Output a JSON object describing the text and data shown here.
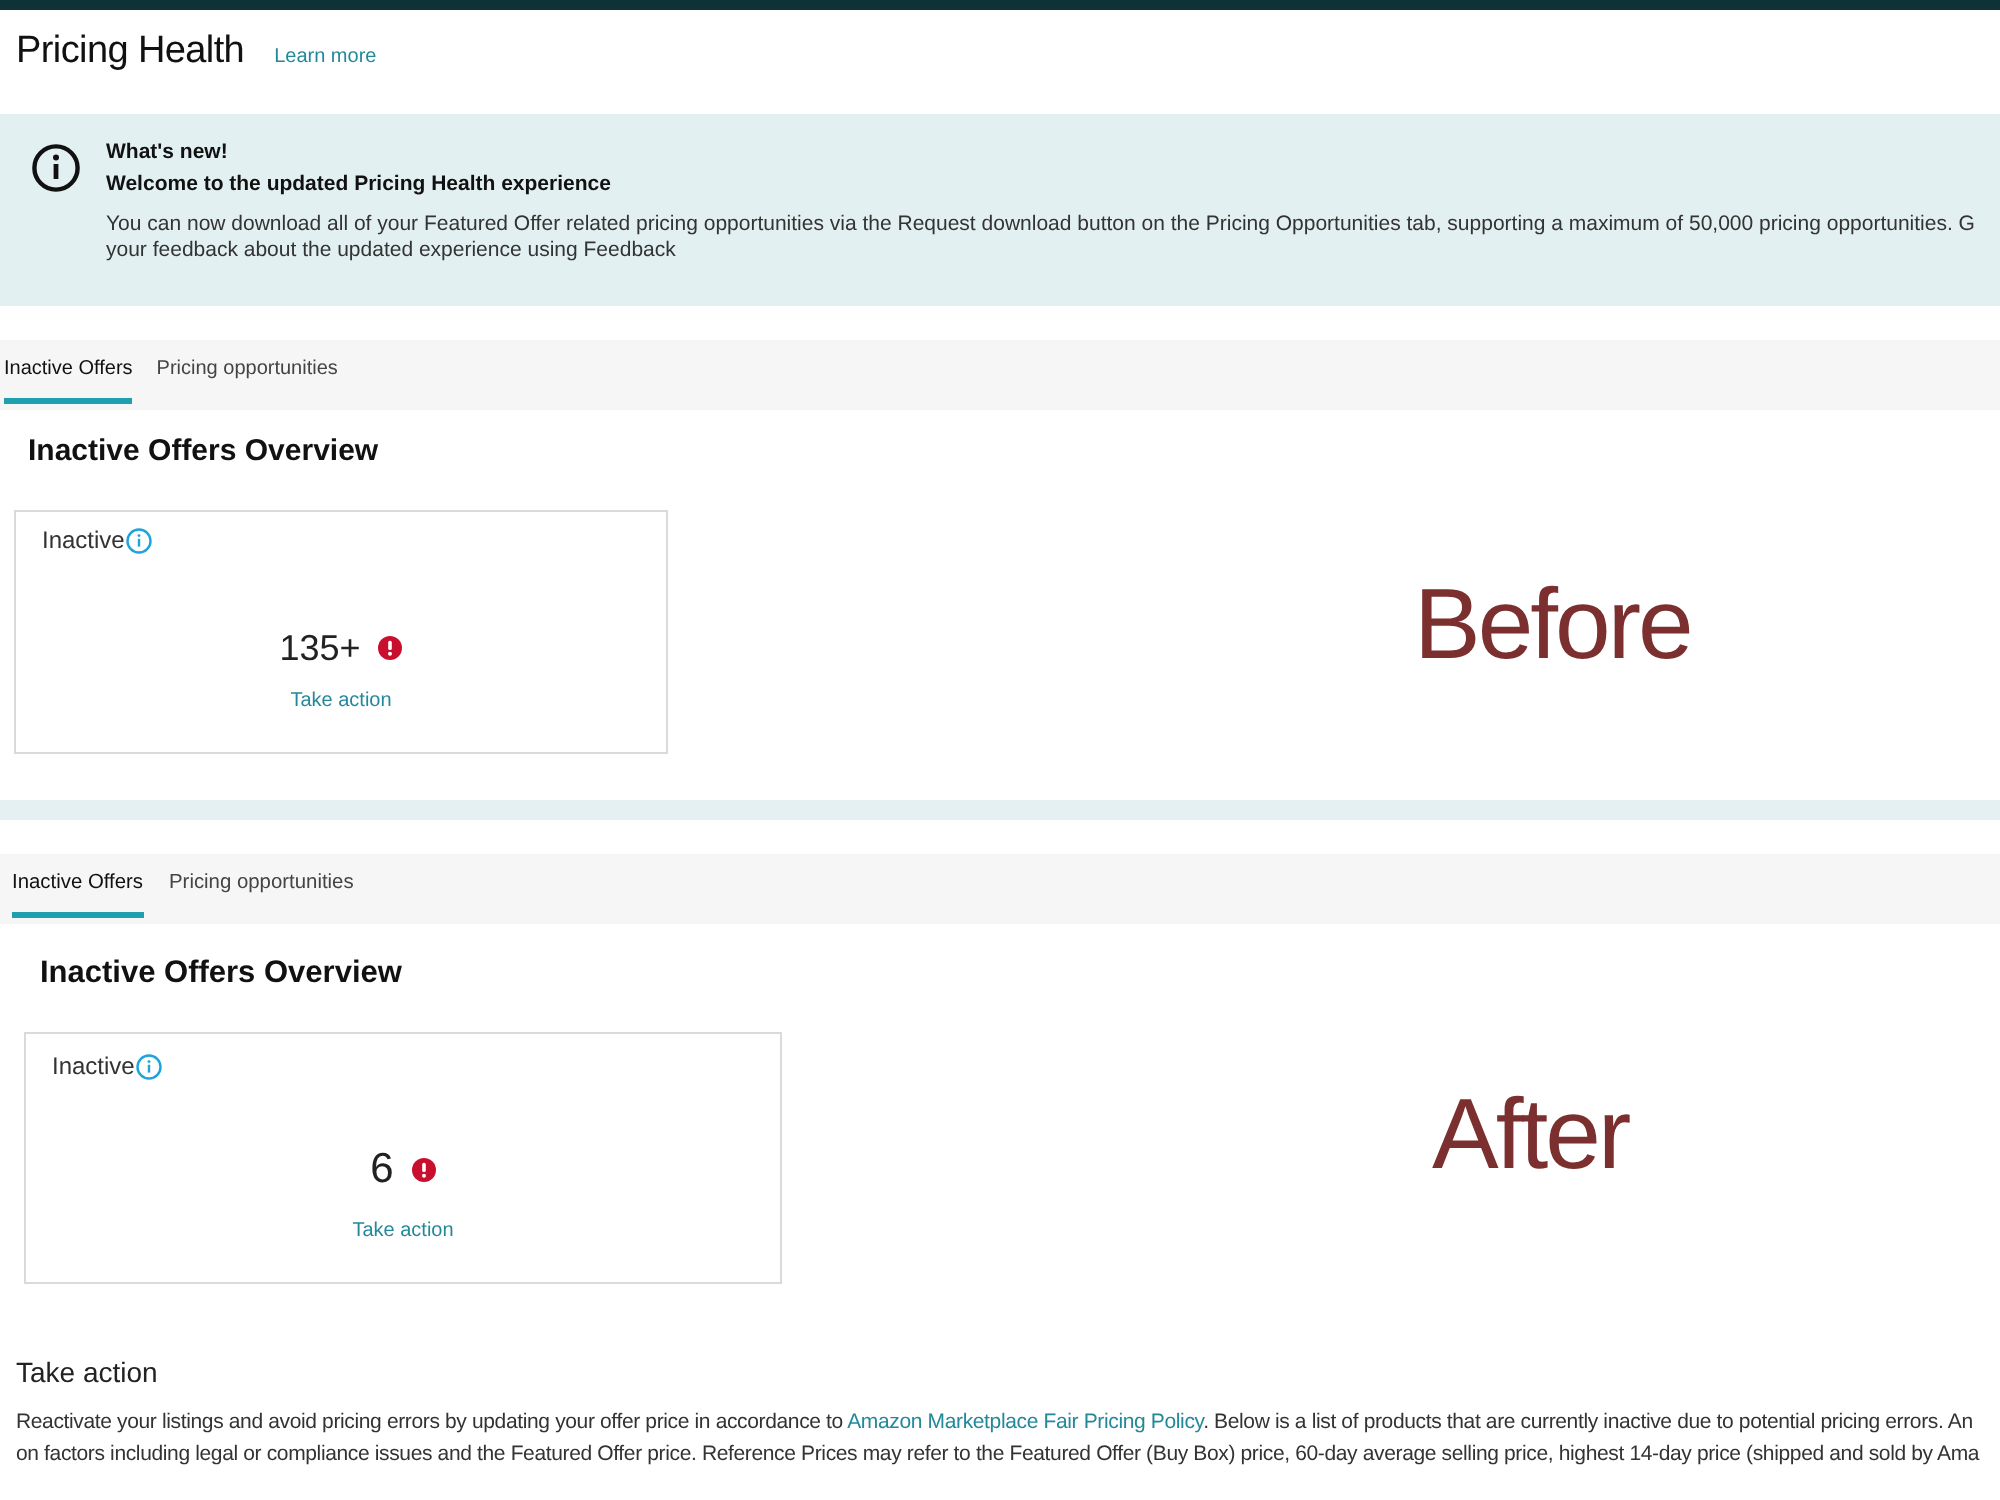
{
  "page": {
    "title": "Pricing Health",
    "learn_more": "Learn more"
  },
  "banner": {
    "heading": "What's new!",
    "subheading": "Welcome to the updated Pricing Health experience",
    "lines": [
      "You can now download all of your Featured Offer related pricing opportunities via the Request download button on the Pricing Opportunities tab, supporting a maximum of 50,000 pricing opportunities. G",
      "your feedback about the updated experience using Feedback"
    ]
  },
  "panels": [
    {
      "caption": "Before",
      "tabs": [
        {
          "label": "Inactive Offers",
          "selected": true
        },
        {
          "label": "Pricing opportunities",
          "selected": false
        }
      ],
      "section_title": "Inactive Offers Overview",
      "card": {
        "label": "Inactive",
        "count": "135+",
        "action": "Take action"
      }
    },
    {
      "caption": "After",
      "tabs": [
        {
          "label": "Inactive Offers",
          "selected": true
        },
        {
          "label": "Pricing opportunities",
          "selected": false
        }
      ],
      "section_title": "Inactive Offers Overview",
      "card": {
        "label": "Inactive",
        "count": "6",
        "action": "Take action"
      }
    }
  ],
  "take_action": {
    "title": "Take action",
    "lines": [
      [
        {
          "kind": "text",
          "text": "Reactivate your listings and avoid pricing errors by updating your offer price in accordance to "
        },
        {
          "kind": "link",
          "text": "Amazon Marketplace Fair Pricing Policy"
        },
        {
          "kind": "text",
          "text": ". Below is a list of products that are currently inactive due to potential pricing errors. An"
        }
      ],
      [
        {
          "kind": "text",
          "text": "on factors including legal or compliance issues and the Featured Offer price. Reference Prices may refer to the Featured Offer (Buy Box) price, 60-day average selling price, highest 14-day price (shipped and sold by Ama"
        }
      ]
    ]
  }
}
